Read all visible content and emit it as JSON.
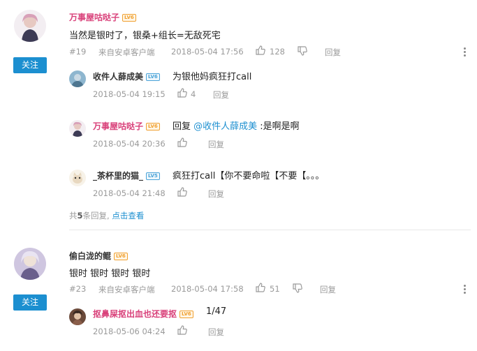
{
  "comments": [
    {
      "author": "万事屋咕哒子",
      "level": "LV6",
      "text": "当然是银时了，银桑+组长=无敌死宅",
      "floor": "#19",
      "source": "来自安卓客户端",
      "time": "2018-05-04 17:56",
      "likes": "128",
      "reply_label": "回复",
      "follow_label": "关注",
      "replies": [
        {
          "author": "收件人薛成美",
          "level": "LV6",
          "text": "为银他妈疯狂打call",
          "time": "2018-05-04 19:15",
          "likes": "4",
          "reply_label": "回复"
        },
        {
          "author": "万事屋咕哒子",
          "level": "LV6",
          "prefix": "回复 ",
          "mention": "@收件人薛成美",
          "text": " :是啊是啊",
          "time": "2018-05-04 20:36",
          "reply_label": "回复"
        },
        {
          "author": "_茶杯里的猫_",
          "level": "LV5",
          "text": "疯狂打call【你不要命啦【不要【。。。",
          "time": "2018-05-04 21:48",
          "reply_label": "回复"
        }
      ],
      "summary_prefix": "共",
      "summary_count": "5",
      "summary_suffix": "条回复,",
      "summary_link": "点击查看"
    },
    {
      "author": "偷白泷的鲲",
      "level": "LV6",
      "text": "银时 银时 银时 银时",
      "floor": "#23",
      "source": "来自安卓客户端",
      "time": "2018-05-04 17:58",
      "likes": "51",
      "reply_label": "回复",
      "follow_label": "关注",
      "replies": [
        {
          "author": "抠鼻屎抠出血也还要抠",
          "level": "LV6",
          "text": "1/47",
          "time": "2018-05-06 04:24",
          "reply_label": "回复"
        }
      ]
    }
  ],
  "colors": {
    "accent": "#1c8fd0",
    "author_pink": "#d9417a"
  },
  "icons": [
    "thumbs-up-icon",
    "thumbs-down-icon",
    "more-vertical-icon"
  ]
}
